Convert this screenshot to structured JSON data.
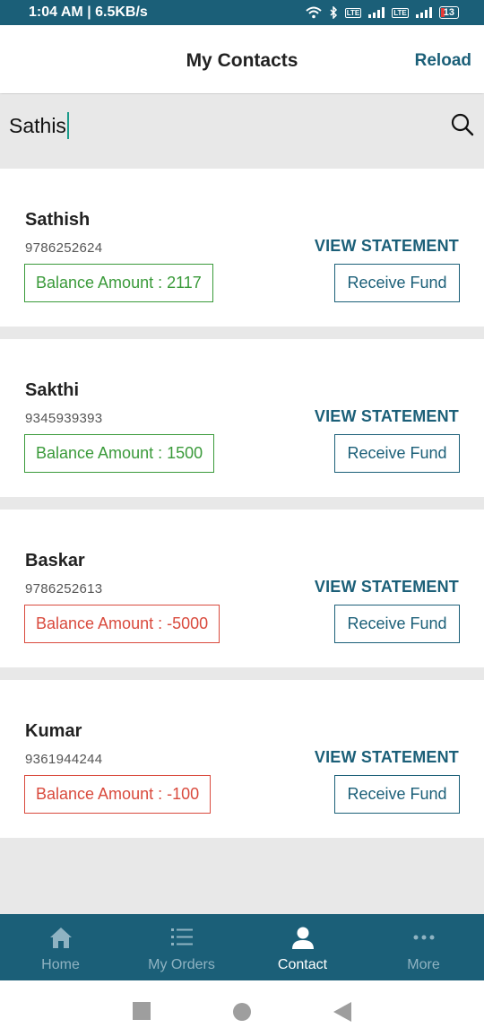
{
  "status_bar": {
    "time_speed": "1:04 AM | 6.5KB/s",
    "battery": "13"
  },
  "header": {
    "title": "My Contacts",
    "reload_label": "Reload"
  },
  "search": {
    "value": "Sathis"
  },
  "contacts": [
    {
      "name": "Sathish",
      "phone": "9786252624",
      "balance": "Balance Amount : 2117",
      "balance_value": 2117,
      "view_label": "VIEW STATEMENT",
      "receive_label": "Receive Fund"
    },
    {
      "name": "Sakthi",
      "phone": "9345939393",
      "balance": "Balance Amount : 1500",
      "balance_value": 1500,
      "view_label": "VIEW STATEMENT",
      "receive_label": "Receive Fund"
    },
    {
      "name": "Baskar",
      "phone": "9786252613",
      "balance": "Balance Amount : -5000",
      "balance_value": -5000,
      "view_label": "VIEW STATEMENT",
      "receive_label": "Receive Fund"
    },
    {
      "name": "Kumar",
      "phone": "9361944244",
      "balance": "Balance Amount : -100",
      "balance_value": -100,
      "view_label": "VIEW STATEMENT",
      "receive_label": "Receive Fund"
    }
  ],
  "bottom_nav": [
    {
      "label": "Home",
      "icon": "home-icon",
      "active": false
    },
    {
      "label": "My Orders",
      "icon": "list-icon",
      "active": false
    },
    {
      "label": "Contact",
      "icon": "person-icon",
      "active": true
    },
    {
      "label": "More",
      "icon": "more-dots-icon",
      "active": false
    }
  ],
  "colors": {
    "primary": "#1b5f78",
    "positive": "#3a9a3a",
    "negative": "#d94a3d",
    "inactive_nav": "#8fb3c2"
  }
}
